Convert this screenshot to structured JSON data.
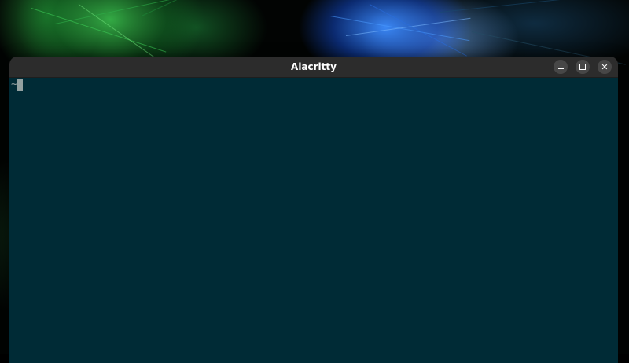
{
  "desktop": {
    "wallpaper": "abstract-light-streaks"
  },
  "window": {
    "title": "Alacritty",
    "buttons": {
      "minimize_icon": "minimize-icon",
      "maximize_icon": "maximize-icon",
      "close_icon": "close-icon",
      "close_glyph": "✕"
    }
  },
  "terminal": {
    "prompt_text": "~",
    "background_color": "#002b36",
    "foreground_color": "#93a1a1"
  },
  "colors": {
    "titlebar": "#2c2c2c",
    "button": "#474747",
    "title_text": "#ffffff"
  }
}
